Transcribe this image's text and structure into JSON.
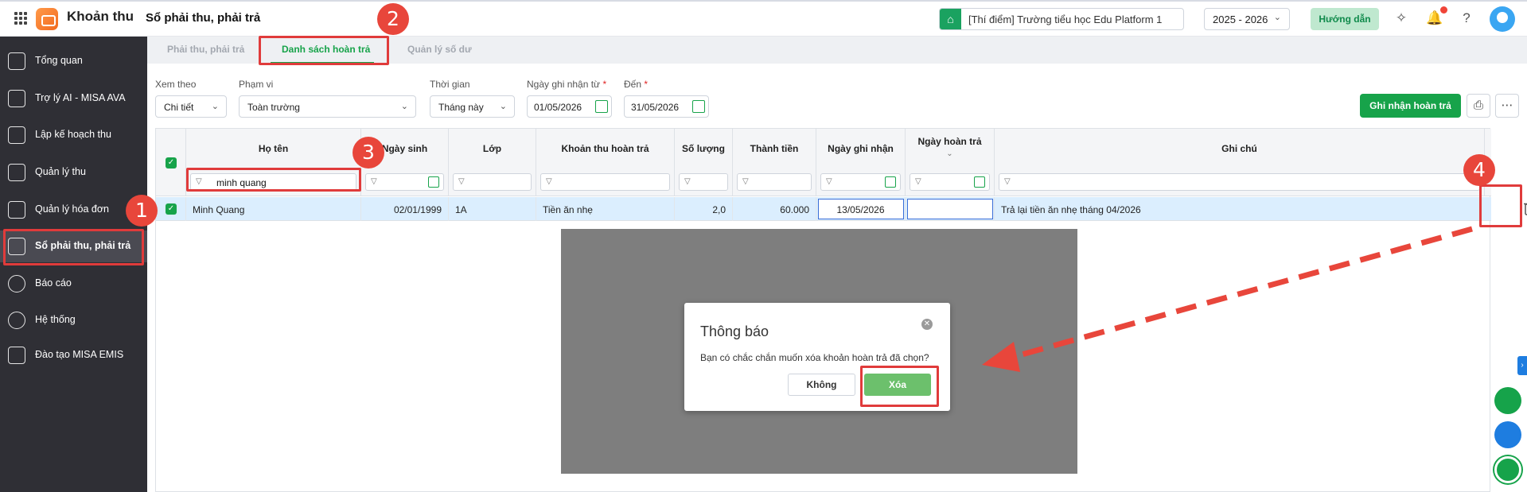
{
  "app": {
    "title": "Khoản thu",
    "page_title": "Sổ phải thu, phải trả"
  },
  "topbar": {
    "school": "[Thí điểm] Trường tiểu học Edu Platform 1",
    "year": "2025 - 2026",
    "guide": "Hướng dẫn"
  },
  "sidebar": {
    "items": [
      {
        "label": "Tổng quan",
        "icon": "chart-bars-icon"
      },
      {
        "label": "Trợ lý AI - MISA AVA",
        "icon": "sparkle-icon"
      },
      {
        "label": "Lập kế hoạch thu",
        "icon": "calendar-money-icon"
      },
      {
        "label": "Quản lý thu",
        "icon": "money-hand-icon"
      },
      {
        "label": "Quản lý hóa đơn",
        "icon": "invoice-icon"
      },
      {
        "label": "Sổ phải thu, phải trả",
        "icon": "ledger-icon"
      },
      {
        "label": "Báo cáo",
        "icon": "pie-chart-icon"
      },
      {
        "label": "Hệ thống",
        "icon": "gear-icon"
      },
      {
        "label": "Đào tạo MISA EMIS",
        "icon": "book-icon"
      }
    ]
  },
  "tabs": [
    "Phải thu, phải trả",
    "Danh sách hoàn trả",
    "Quản lý số dư"
  ],
  "filters": {
    "view_label": "Xem theo",
    "view_value": "Chi tiết",
    "scope_label": "Phạm vi",
    "scope_value": "Toàn trường",
    "time_label": "Thời gian",
    "time_value": "Tháng này",
    "from_label": "Ngày ghi nhận từ",
    "from_value": "01/05/2026",
    "to_label": "Đến",
    "to_value": "31/05/2026",
    "required": "*"
  },
  "actions": {
    "record_refund": "Ghi nhận hoàn trả"
  },
  "table": {
    "headers": [
      "Họ tên",
      "Ngày sinh",
      "Lớp",
      "Khoản thu hoàn trả",
      "Số lượng",
      "Thành tiền",
      "Ngày ghi nhận",
      "Ngày hoàn trả",
      "Ghi chú"
    ],
    "name_filter": "minh quang",
    "row": {
      "name": "Minh Quang",
      "dob": "02/01/1999",
      "class": "1A",
      "fee": "Tiền ăn nhẹ",
      "qty": "2,0",
      "amount": "60.000",
      "recorded": "13/05/2026",
      "refunded": "",
      "note": "Trả lại tiền ăn nhẹ tháng 04/2026"
    }
  },
  "dialog": {
    "title": "Thông báo",
    "message": "Bạn có chắc chắn muốn xóa khoản hoàn trả đã chọn?",
    "cancel": "Không",
    "confirm": "Xóa"
  },
  "badges": [
    "1",
    "2",
    "3",
    "4"
  ],
  "colors": {
    "primary": "#17a34a",
    "callout": "#e03b3b",
    "sidebar": "#2f2f35"
  }
}
